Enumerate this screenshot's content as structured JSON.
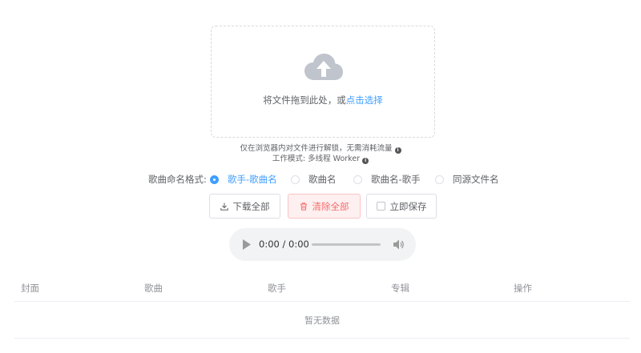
{
  "upload": {
    "icon": "upload-cloud-icon",
    "prompt_text": "将文件拖到此处，或",
    "prompt_link": "点击选择"
  },
  "tips": {
    "line1": "仅在浏览器内对文件进行解锁，无需消耗流量",
    "line2": "工作模式: 多线程 Worker",
    "info_icon": "info-icon"
  },
  "naming": {
    "label": "歌曲命名格式:",
    "options": [
      "歌手-歌曲名",
      "歌曲名",
      "歌曲名-歌手",
      "同源文件名"
    ],
    "selected": "歌手-歌曲名"
  },
  "actions": {
    "download_all": "下载全部",
    "clear_all": "清除全部",
    "save_now": "立即保存",
    "colors": {
      "danger": "#f56c6c",
      "accent": "#409eff"
    }
  },
  "player": {
    "time": "0:00 / 0:00",
    "progress": 0
  },
  "table": {
    "columns": [
      "封面",
      "歌曲",
      "歌手",
      "专辑",
      "操作"
    ],
    "empty_text": "暂无数据"
  }
}
